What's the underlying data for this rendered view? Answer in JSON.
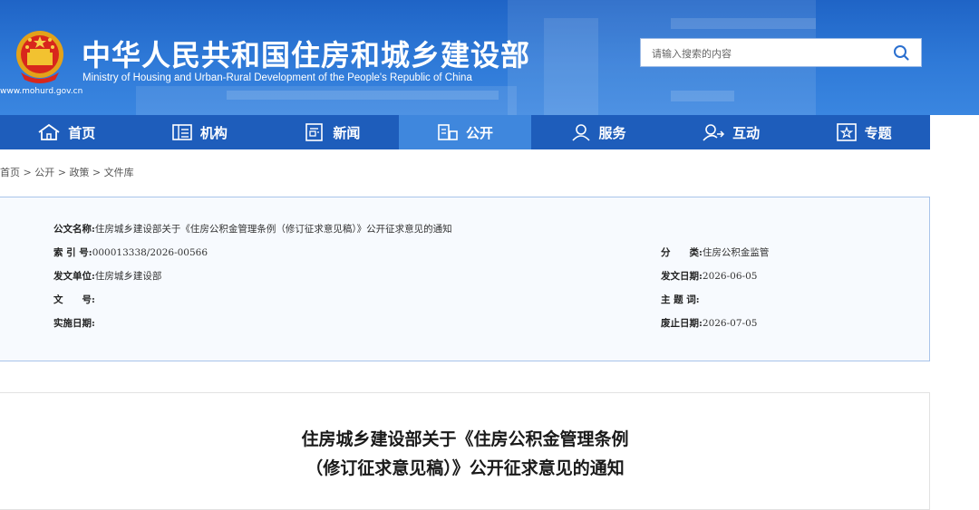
{
  "header": {
    "site_title_cn": "中华人民共和国住房和城乡建设部",
    "site_title_en": "Ministry of Housing and Urban-Rural Development of the People's Republic of China",
    "site_url": "www.mohurd.gov.cn",
    "search_placeholder": "请输入搜索的内容"
  },
  "nav": {
    "items": [
      {
        "label": "首页",
        "icon": "home-icon"
      },
      {
        "label": "机构",
        "icon": "building-icon"
      },
      {
        "label": "新闻",
        "icon": "news-icon"
      },
      {
        "label": "公开",
        "icon": "public-icon"
      },
      {
        "label": "服务",
        "icon": "service-icon"
      },
      {
        "label": "互动",
        "icon": "interaction-icon"
      },
      {
        "label": "专题",
        "icon": "topic-icon"
      }
    ],
    "active_index": 3
  },
  "breadcrumb": [
    "首页",
    "公开",
    "政策",
    "文件库"
  ],
  "breadcrumb_separator": " > ",
  "meta": {
    "doc_name_label": "公文名称:",
    "doc_name": "住房城乡建设部关于《住房公积金管理条例（修订征求意见稿）》公开征求意见的通知",
    "index_label": "索 引 号:",
    "index_value": "000013338/2026-00566",
    "category_label": "分　　类:",
    "category_value": "住房公积金监管",
    "issuer_label": "发文单位:",
    "issuer_value": "住房城乡建设部",
    "issue_date_label": "发文日期:",
    "issue_date_value": "2026-06-05",
    "doc_no_label": "文　　号:",
    "doc_no_value": "",
    "keywords_label": "主 题 词:",
    "keywords_value": "",
    "effective_date_label": "实施日期:",
    "effective_date_value": "",
    "expiry_date_label": "废止日期:",
    "expiry_date_value": "2026-07-05"
  },
  "document": {
    "title_line1": "住房城乡建设部关于《住房公积金管理条例",
    "title_line2": "（修订征求意见稿）》公开征求意见的通知"
  },
  "colors": {
    "header_blue": "#2f7ad8",
    "nav_blue": "#1e5dbb",
    "nav_active": "#3f87dd",
    "meta_border": "#a9c4ea",
    "meta_bg": "#f7fafe"
  }
}
